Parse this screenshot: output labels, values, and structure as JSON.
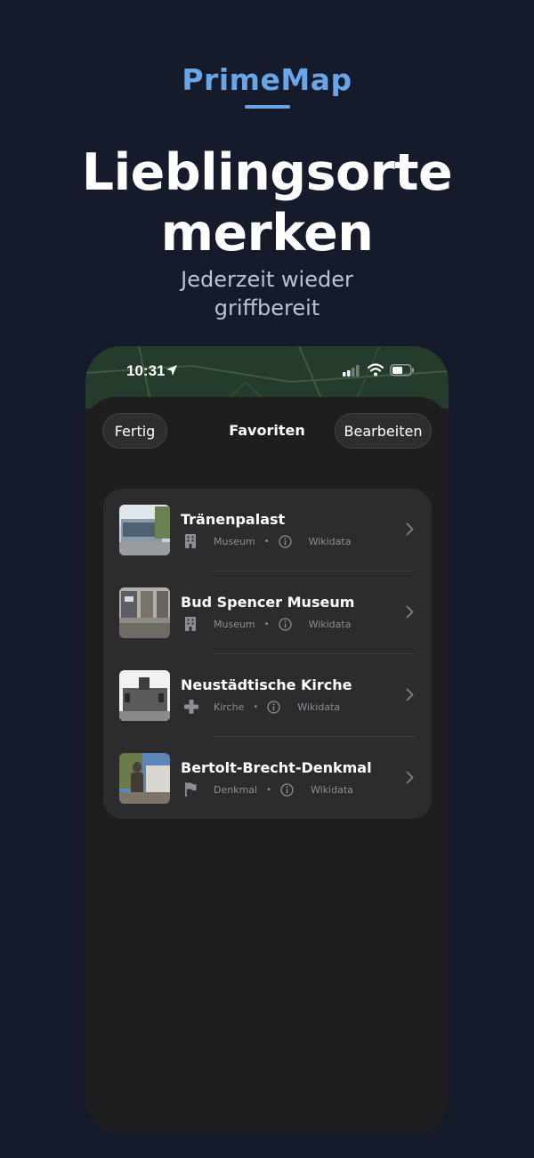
{
  "brand": "PrimeMap",
  "headline_line1": "Lieblingsorte",
  "headline_line2": "merken",
  "subline_line1": "Jederzeit wieder",
  "subline_line2": "griffbereit",
  "status": {
    "time": "10:31"
  },
  "nav": {
    "done_label": "Fertig",
    "title": "Favoriten",
    "edit_label": "Bearbeiten"
  },
  "favorites": [
    {
      "title": "Tränenpalast",
      "category": "Museum",
      "category_icon": "building-icon",
      "source": "Wikidata"
    },
    {
      "title": "Bud Spencer Museum",
      "category": "Museum",
      "category_icon": "building-icon",
      "source": "Wikidata"
    },
    {
      "title": "Neustädtische Kirche",
      "category": "Kirche",
      "category_icon": "cross-icon",
      "source": "Wikidata"
    },
    {
      "title": "Bertolt-Brecht-Denkmal",
      "category": "Denkmal",
      "category_icon": "flag-icon",
      "source": "Wikidata"
    }
  ],
  "colors": {
    "background": "#161b2b",
    "accent": "#6aa5e8",
    "sheet": "#1e1e20",
    "card": "#2c2c2e"
  }
}
